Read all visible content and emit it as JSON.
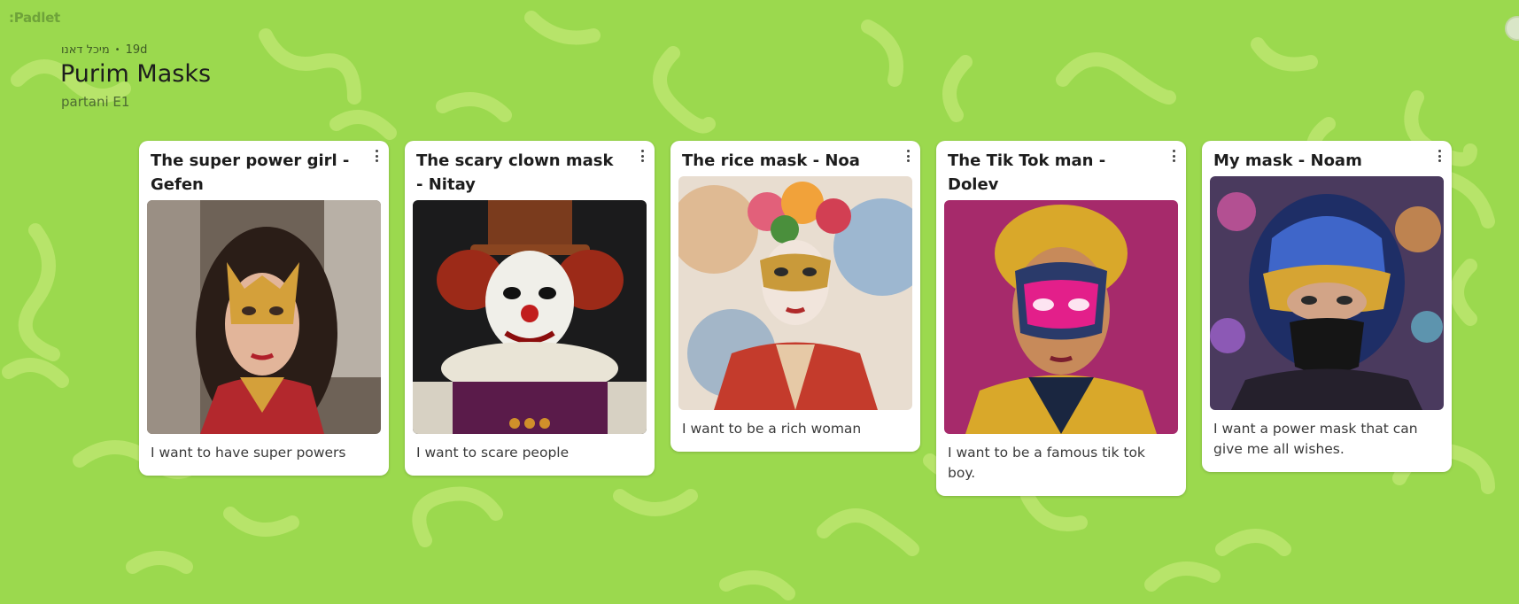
{
  "app": {
    "logo": ":Padlet"
  },
  "board": {
    "author": "מיכל דאנו",
    "age": "19d",
    "title": "Purim Masks",
    "subtitle": "partani E1"
  },
  "colors": {
    "wallpaper": "#9bd94e",
    "wallpaper_swirl": "#b5e266",
    "card_bg": "#ffffff"
  },
  "posts": [
    {
      "title": "The super power girl - Gefen",
      "image": "superhero-mask-portrait",
      "body": "I want to have super powers"
    },
    {
      "title": "The scary clown mask - Nitay",
      "image": "scary-clown-portrait",
      "body": "I want to scare people"
    },
    {
      "title": "The rice mask - Noa",
      "image": "floral-venetian-mask-portrait",
      "body": "I want to be a rich woman"
    },
    {
      "title": "The Tik Tok man - Dolev",
      "image": "pink-neon-mask-portrait",
      "body": "I want to be a famous tik tok boy."
    },
    {
      "title": "My mask - Noam",
      "image": "golden-helmet-mask-portrait",
      "body": "I want a power mask that can give me all wishes."
    }
  ]
}
